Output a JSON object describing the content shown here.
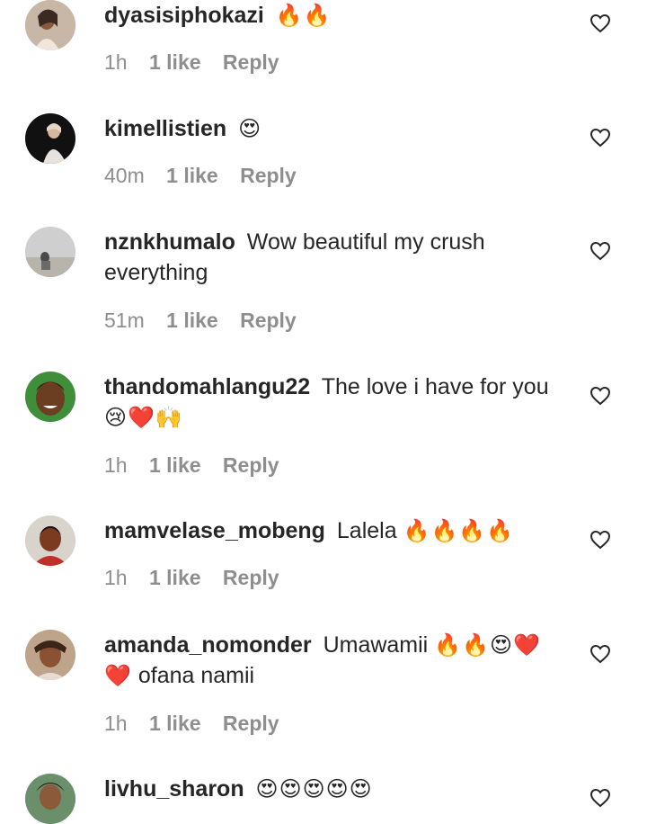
{
  "comments": [
    {
      "username": "dyasisiphokazi",
      "text": "",
      "emoji": "🔥🔥",
      "text_after": "",
      "time": "1h",
      "likes": "1 like",
      "reply": "Reply",
      "avatar_colors": [
        "#c8b6a6",
        "#3a2a22"
      ]
    },
    {
      "username": "kimellistien",
      "text": "",
      "emoji": "😍",
      "text_after": "",
      "time": "40m",
      "likes": "1 like",
      "reply": "Reply",
      "avatar_colors": [
        "#111111",
        "#e8e2dc"
      ]
    },
    {
      "username": "nznkhumalo",
      "text": "Wow beautiful my crush everything",
      "emoji": "",
      "text_after": "",
      "time": "51m",
      "likes": "1 like",
      "reply": "Reply",
      "avatar_colors": [
        "#cfcfcf",
        "#4a4a4a"
      ]
    },
    {
      "username": "thandomahlangu22",
      "text": "The love i have for you",
      "emoji": "😢❤️🙌",
      "text_after": "",
      "time": "1h",
      "likes": "1 like",
      "reply": "Reply",
      "avatar_colors": [
        "#3f8f3a",
        "#2a1a12"
      ]
    },
    {
      "username": "mamvelase_mobeng",
      "text": "Lalela",
      "emoji": "🔥🔥🔥🔥",
      "text_after": "",
      "time": "1h",
      "likes": "1 like",
      "reply": "Reply",
      "avatar_colors": [
        "#d8d4cc",
        "#7a3b20"
      ]
    },
    {
      "username": "amanda_nomonder",
      "text": "Umawamii",
      "emoji": "🔥🔥😍❤️ ❤️",
      "text_after": "ofana namii",
      "time": "1h",
      "likes": "1 like",
      "reply": "Reply",
      "avatar_colors": [
        "#bfa48c",
        "#3b2418"
      ]
    },
    {
      "username": "livhu_sharon",
      "text": "",
      "emoji": "😍😍😍😍😍",
      "text_after": "",
      "time": "",
      "likes": "",
      "reply": "",
      "avatar_colors": [
        "#6b8f6a",
        "#2b1b12"
      ]
    }
  ],
  "heart_icon": "heart-outline-icon",
  "colors": {
    "text": "#262626",
    "meta": "#8e8e8e",
    "heart": "#262626"
  }
}
